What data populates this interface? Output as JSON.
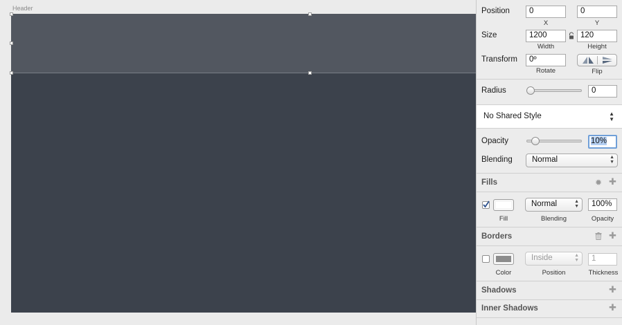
{
  "canvas": {
    "artboard_label": "Header",
    "colors": {
      "artboard": "#3c424c",
      "header_layer": "#525760",
      "canvas_bg": "#ebebeb"
    }
  },
  "inspector": {
    "position": {
      "label": "Position",
      "x_value": "0",
      "y_value": "0",
      "x_caption": "X",
      "y_caption": "Y"
    },
    "size": {
      "label": "Size",
      "width_value": "1200",
      "height_value": "120",
      "width_caption": "Width",
      "height_caption": "Height",
      "lock_icon": "lock-icon"
    },
    "transform": {
      "label": "Transform",
      "rotate_value": "0º",
      "rotate_caption": "Rotate",
      "flip_caption": "Flip"
    },
    "radius": {
      "label": "Radius",
      "value": "0",
      "level": 0
    },
    "shared_style": {
      "value": "No Shared Style"
    },
    "opacity": {
      "label": "Opacity",
      "value": "10%",
      "level": 0.1
    },
    "blending": {
      "label": "Blending",
      "value": "Normal"
    },
    "fills": {
      "title": "Fills",
      "checked": true,
      "swatch_color": "#ffffff",
      "blending_value": "Normal",
      "opacity_value": "100%",
      "fill_caption": "Fill",
      "blending_caption": "Blending",
      "opacity_caption": "Opacity"
    },
    "borders": {
      "title": "Borders",
      "checked": false,
      "swatch_color": "#8c8c8c",
      "position_value": "Inside",
      "thickness_value": "1",
      "color_caption": "Color",
      "position_caption": "Position",
      "thickness_caption": "Thickness"
    },
    "shadows": {
      "title": "Shadows"
    },
    "inner_shadows": {
      "title": "Inner Shadows"
    }
  }
}
